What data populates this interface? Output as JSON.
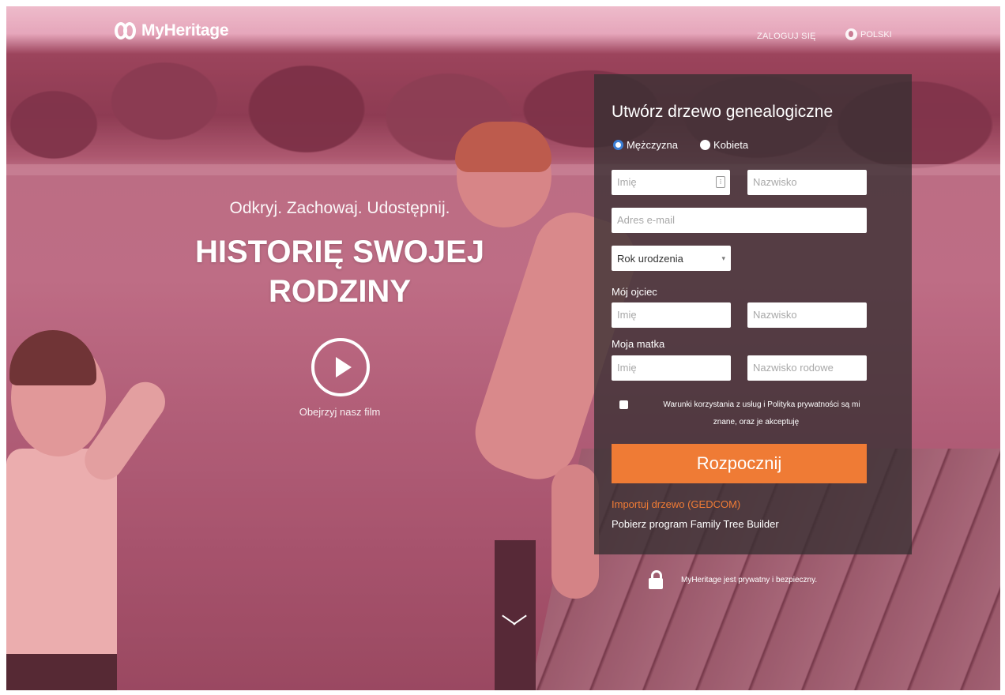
{
  "header": {
    "logo_text": "MyHeritage",
    "login_label": "ZALOGUJ SIĘ",
    "language_label": "POLSKI"
  },
  "hero": {
    "tagline": "Odkryj. Zachowaj. Udostępnij.",
    "headline": "HISTORIĘ SWOJEJ RODZINY",
    "watch_label": "Obejrzyj nasz film"
  },
  "form": {
    "title": "Utwórz drzewo genealogiczne",
    "gender_male": "Mężczyzna",
    "gender_female": "Kobieta",
    "first_name_placeholder": "Imię",
    "last_name_placeholder": "Nazwisko",
    "email_placeholder": "Adres e-mail",
    "birth_year_value": "Rok urodzenia",
    "father_label": "Mój ojciec",
    "father_first_placeholder": "Imię",
    "father_last_placeholder": "Nazwisko",
    "mother_label": "Moja matka",
    "mother_first_placeholder": "Imię",
    "mother_last_placeholder": "Nazwisko rodowe",
    "terms_line1": "Warunki korzystania z usług i Polityka prywatności są mi",
    "terms_line2": "znane, oraz je akceptuję",
    "submit_label": "Rozpocznij",
    "import_link": "Importuj drzewo (GEDCOM)",
    "download_link": "Pobierz program Family Tree Builder"
  },
  "secure_text": "MyHeritage jest prywatny i bezpieczny.",
  "colors": {
    "accent": "#ef7b35",
    "panel_bg": "#373032",
    "radio_selected": "#3b7fd6"
  }
}
